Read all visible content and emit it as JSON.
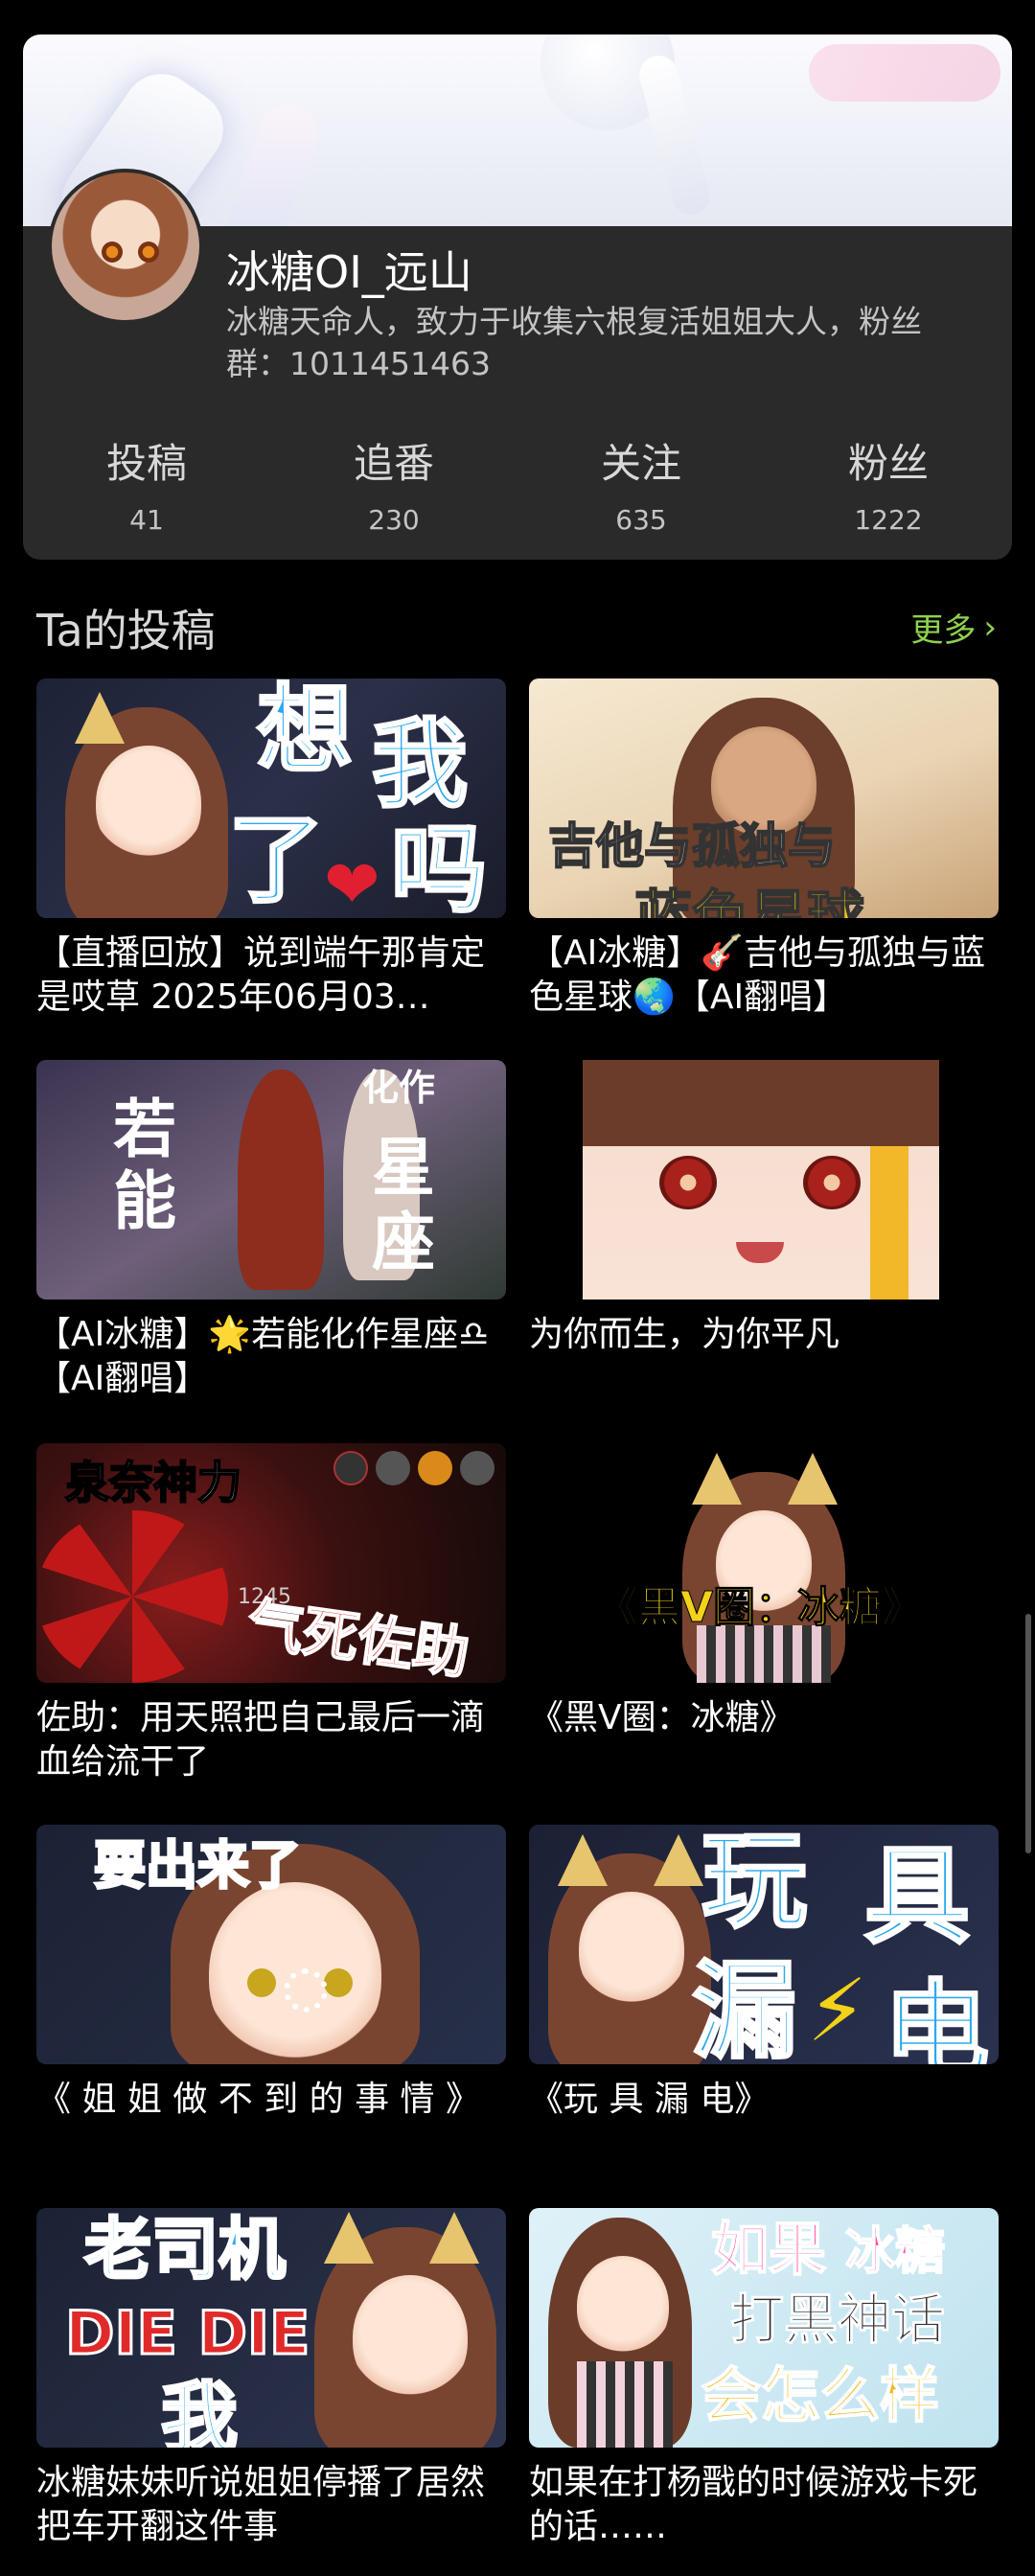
{
  "profile": {
    "username": "冰糖OI_远山",
    "bio": "冰糖天命人，致力于收集六根复活姐姐大人，粉丝群：1011451463",
    "stats": [
      {
        "label": "投稿",
        "value": "41"
      },
      {
        "label": "追番",
        "value": "230"
      },
      {
        "label": "关注",
        "value": "635"
      },
      {
        "label": "粉丝",
        "value": "1222"
      }
    ]
  },
  "section": {
    "title": "Ta的投稿",
    "more_label": "更多"
  },
  "videos": [
    {
      "title": "【直播回放】说到端午那肯定是哎草 2025年06月03…",
      "thumb_text": [
        "想",
        "我",
        "了",
        "吗"
      ]
    },
    {
      "title": "【AI冰糖】🎸吉他与孤独与蓝色星球🌏【AI翻唱】",
      "thumb_text": [
        "吉他与孤独与",
        "蓝色星球"
      ]
    },
    {
      "title": "【AI冰糖】🌟若能化作星座♎【AI翻唱】",
      "thumb_text": [
        "若",
        "能",
        "化作",
        "星",
        "座"
      ]
    },
    {
      "title": "为你而生，为你平凡",
      "thumb_text": []
    },
    {
      "title": "佐助：用天照把自己最后一滴血给流干了",
      "thumb_text": [
        "泉奈神力",
        "气死佐助",
        "1245"
      ]
    },
    {
      "title": "《黑V圈：冰糖》",
      "thumb_text": [
        "《黑V圈：冰糖》"
      ]
    },
    {
      "title": "《 姐 姐 做 不 到 的 事 情 》",
      "thumb_text": [
        "要出来了"
      ]
    },
    {
      "title": "《玩 具 漏 电》",
      "thumb_text": [
        "玩",
        "具",
        "漏",
        "电"
      ]
    },
    {
      "title": "冰糖妹妹听说姐姐停播了居然把车开翻这件事",
      "thumb_text": [
        "老司机",
        "DIE DIE",
        "我"
      ]
    },
    {
      "title": "如果在打杨戬的时候游戏卡死的话……",
      "thumb_text": [
        "如果",
        "冰糖",
        "打黑神话",
        "会怎么样"
      ]
    }
  ],
  "colors": {
    "background": "#000000",
    "card": "#2a2a2a",
    "accent_more": "#8fd14f",
    "text_primary": "#ffffff",
    "text_secondary": "#c4c4c4"
  }
}
